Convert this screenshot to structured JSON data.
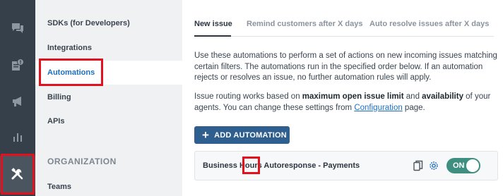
{
  "rail": {
    "items": [
      {
        "icon": "chat-icon"
      },
      {
        "icon": "notes-alert-icon"
      },
      {
        "icon": "megaphone-icon"
      },
      {
        "icon": "bar-chart-icon"
      },
      {
        "icon": "tools-icon",
        "active": true
      }
    ]
  },
  "nav": {
    "items": [
      {
        "label": "SDKs (for Developers)"
      },
      {
        "label": "Integrations"
      },
      {
        "label": "Automations",
        "active": true
      },
      {
        "label": "Billing"
      },
      {
        "label": "APIs"
      }
    ],
    "section_label": "ORGANIZATION",
    "teams_label": "Teams"
  },
  "main": {
    "tabs": [
      {
        "label": "New issue",
        "active": true
      },
      {
        "label": "Remind customers after X days"
      },
      {
        "label": "Auto resolve issues after X days"
      }
    ],
    "description": "Use these automations to perform a set of actions on new incoming issues matching certain filters. The automations run in the specified order below. If an automation rejects or resolves an issue, no further automation rules will apply.",
    "routing": {
      "prefix": "Issue routing works based on ",
      "bold1": "maximum open issue limit",
      "mid": " and ",
      "bold2": "availability",
      "mid2": " of your agents. You can change these settings from ",
      "link": "Configuration",
      "suffix": " page."
    },
    "add_button_label": "ADD AUTOMATION",
    "automation": {
      "title": "Business Hours Autoresponse - Payments",
      "toggle_label": "ON",
      "enabled": true
    }
  },
  "colors": {
    "rail_bg": "#36404a",
    "nav_bg": "#f0f1f2",
    "link": "#1f6fbf",
    "button": "#2f5f8f",
    "toggle_on": "#3f8f80",
    "highlight": "#e3101d"
  }
}
